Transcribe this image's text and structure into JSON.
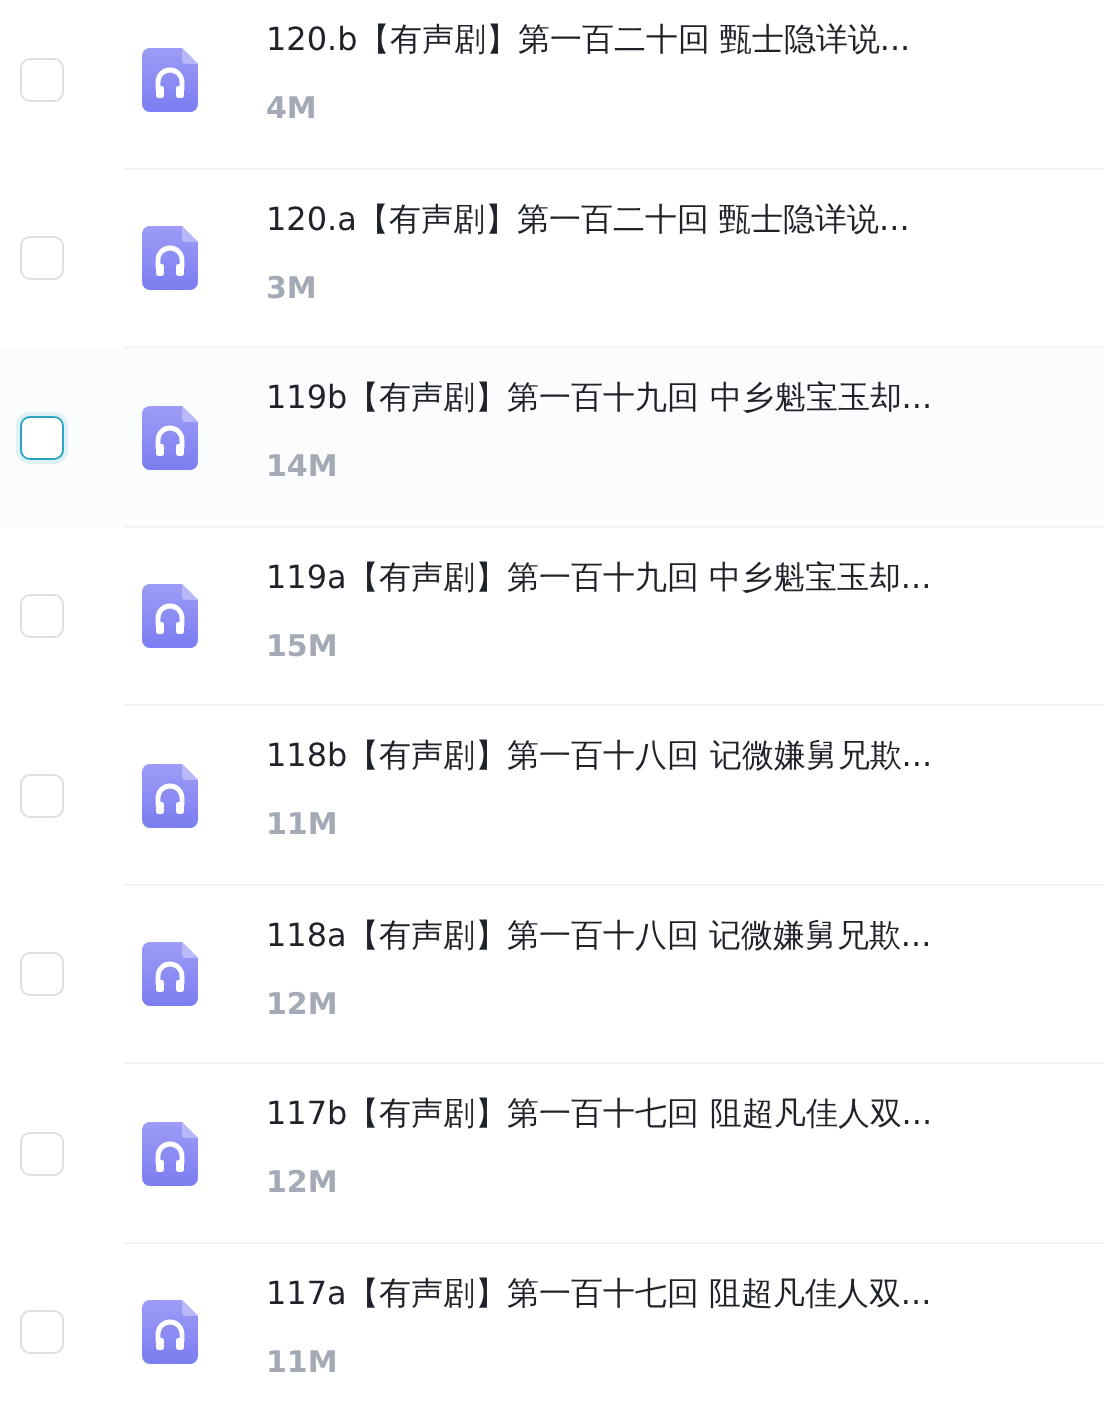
{
  "files": [
    {
      "title": "120.b【有声剧】第一百二十回 甄士隐详说...",
      "size": "4M",
      "checked": false,
      "focused": false
    },
    {
      "title": "120.a【有声剧】第一百二十回 甄士隐详说...",
      "size": "3M",
      "checked": false,
      "focused": false
    },
    {
      "title": "119b【有声剧】第一百十九回 中乡魁宝玉却...",
      "size": "14M",
      "checked": false,
      "focused": true
    },
    {
      "title": "119a【有声剧】第一百十九回 中乡魁宝玉却...",
      "size": "15M",
      "checked": false,
      "focused": false
    },
    {
      "title": "118b【有声剧】第一百十八回 记微嫌舅兄欺...",
      "size": "11M",
      "checked": false,
      "focused": false
    },
    {
      "title": "118a【有声剧】第一百十八回 记微嫌舅兄欺...",
      "size": "12M",
      "checked": false,
      "focused": false
    },
    {
      "title": "117b【有声剧】第一百十七回 阻超凡佳人双...",
      "size": "12M",
      "checked": false,
      "focused": false
    },
    {
      "title": "117a【有声剧】第一百十七回 阻超凡佳人双...",
      "size": "11M",
      "checked": false,
      "focused": false
    }
  ]
}
